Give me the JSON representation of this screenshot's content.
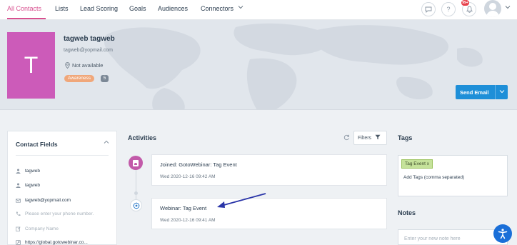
{
  "nav": {
    "tabs": [
      {
        "label": "All Contacts"
      },
      {
        "label": "Lists"
      },
      {
        "label": "Lead Scoring"
      },
      {
        "label": "Goals"
      },
      {
        "label": "Audiences"
      },
      {
        "label": "Connectors"
      }
    ],
    "notification_count": "99+",
    "icons": [
      "chat-icon",
      "help-icon",
      "bell-icon",
      "user-avatar"
    ]
  },
  "contact": {
    "initial": "T",
    "name": "tagweb tagweb",
    "email": "tagweb@yopmail.com",
    "location": "Not available",
    "stage": "Awareness",
    "score": "5",
    "avatar_color": "#cc5bb9"
  },
  "actions": {
    "send_email": "Send Email"
  },
  "contact_fields": {
    "title": "Contact Fields",
    "rows": [
      {
        "icon": "person-icon",
        "text": "tagweb",
        "placeholder": false
      },
      {
        "icon": "person-icon",
        "text": "tagweb",
        "placeholder": false
      },
      {
        "icon": "envelope-icon",
        "text": "tagweb@yopmail.com",
        "placeholder": false
      },
      {
        "icon": "phone-icon",
        "text": "Please enter your phone number.",
        "placeholder": true
      },
      {
        "icon": "edit-icon",
        "text": "Company Name",
        "placeholder": true
      },
      {
        "icon": "link-icon",
        "text": "https://global.gotowebinar.co...",
        "placeholder": false
      }
    ]
  },
  "activities": {
    "title": "Activities",
    "filters_label": "Filters",
    "items": [
      {
        "title": "Joined: GotoWebinar: Tag Event",
        "date": "Wed 2020-12-16 09:42 AM"
      },
      {
        "title": "Webinar: Tag Event",
        "date": "Wed 2020-12-16 09:41 AM"
      }
    ]
  },
  "tags": {
    "title": "Tags",
    "chips": [
      {
        "label": "Tag Event"
      }
    ],
    "hint": "Add Tags (comma separated)"
  },
  "notes": {
    "title": "Notes",
    "placeholder": "Enter your new note here"
  },
  "colors": {
    "accent": "#d8508f",
    "primary_button": "#1e8fd8",
    "stage_pill": "#f0a77a",
    "tag_chip": "#c5e29a"
  }
}
